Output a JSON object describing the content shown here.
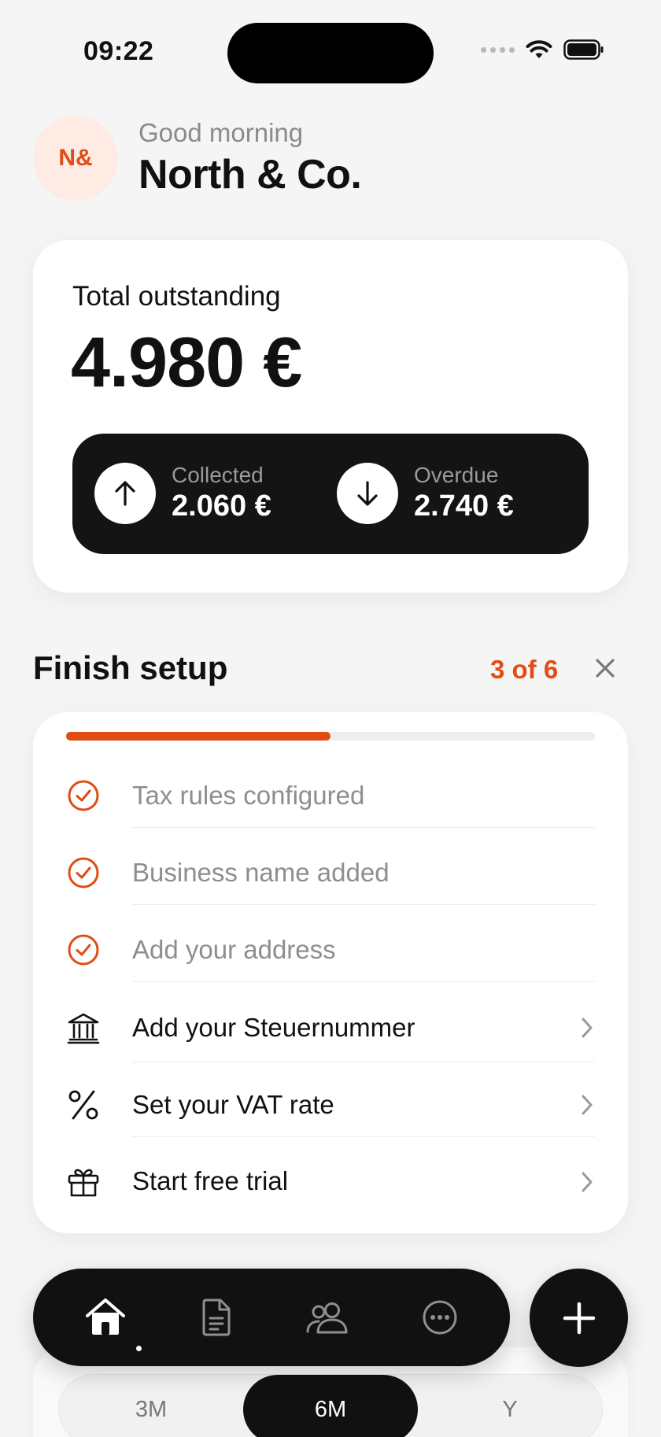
{
  "status_bar": {
    "time": "09:22"
  },
  "header": {
    "avatar_initials": "N&",
    "greeting": "Good morning",
    "company_name": "North & Co."
  },
  "summary": {
    "total_label": "Total outstanding",
    "total_amount": "4.980 €",
    "collected": {
      "label": "Collected",
      "amount": "2.060 €",
      "icon": "arrow-up-icon"
    },
    "overdue": {
      "label": "Overdue",
      "amount": "2.740 €",
      "icon": "arrow-down-icon"
    }
  },
  "setup": {
    "title": "Finish setup",
    "progress_text": "3 of 6",
    "progress_fraction": 0.5,
    "accent_color": "#e04d14",
    "items": [
      {
        "label": "Tax rules configured",
        "done": true,
        "icon": "check-circle-icon"
      },
      {
        "label": "Business name added",
        "done": true,
        "icon": "check-circle-icon"
      },
      {
        "label": "Add your address",
        "done": true,
        "icon": "check-circle-icon"
      },
      {
        "label": "Add your Steuernummer",
        "done": false,
        "icon": "bank-icon"
      },
      {
        "label": "Set your VAT rate",
        "done": false,
        "icon": "percent-icon"
      },
      {
        "label": "Start free trial",
        "done": false,
        "icon": "gift-icon"
      }
    ]
  },
  "bottom_nav": {
    "items": [
      {
        "name": "home",
        "icon": "home-icon",
        "active": true
      },
      {
        "name": "documents",
        "icon": "document-icon",
        "active": false
      },
      {
        "name": "clients",
        "icon": "people-icon",
        "active": false
      },
      {
        "name": "more",
        "icon": "more-icon",
        "active": false
      }
    ],
    "fab_icon": "plus-icon"
  },
  "period_selector": {
    "options": [
      "3M",
      "6M",
      "Y"
    ],
    "selected": "6M"
  }
}
